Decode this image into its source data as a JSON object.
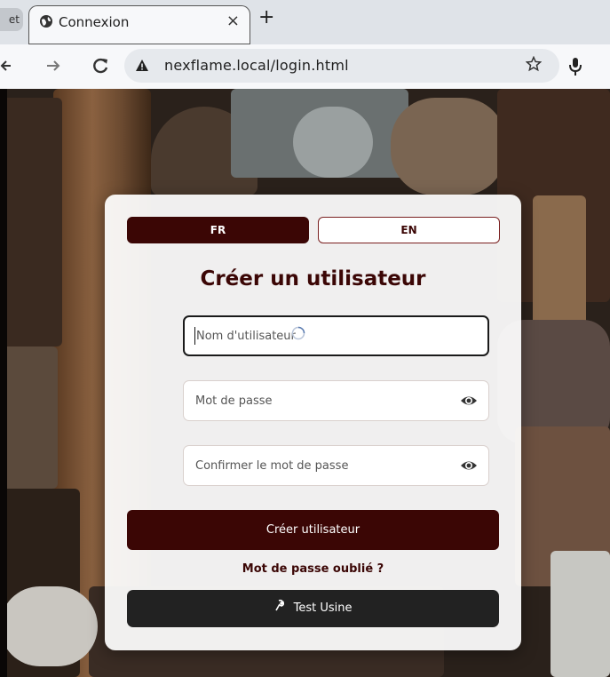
{
  "browser": {
    "prev_tab_label": "et",
    "active_tab_title": "Connexion",
    "tab_close": "×",
    "new_tab": "+",
    "url": "nexflame.local/login.html"
  },
  "language": {
    "fr_label": "FR",
    "en_label": "EN",
    "selected": "FR"
  },
  "form": {
    "title": "Créer un utilisateur",
    "username_placeholder": "Nom d'utilisateur",
    "password_placeholder": "Mot de passe",
    "confirm_placeholder": "Confirmer le mot de passe",
    "submit_label": "Créer utilisateur",
    "forgot_label": "Mot de passe oublié ?",
    "test_label": "Test Usine"
  },
  "colors": {
    "brand": "#3b0605",
    "dark_button": "#222222"
  },
  "icons": [
    "globe-icon",
    "close-icon",
    "back-arrow-icon",
    "forward-arrow-icon",
    "reload-icon",
    "warning-icon",
    "star-icon",
    "mic-icon",
    "eye-icon",
    "wrench-icon"
  ]
}
